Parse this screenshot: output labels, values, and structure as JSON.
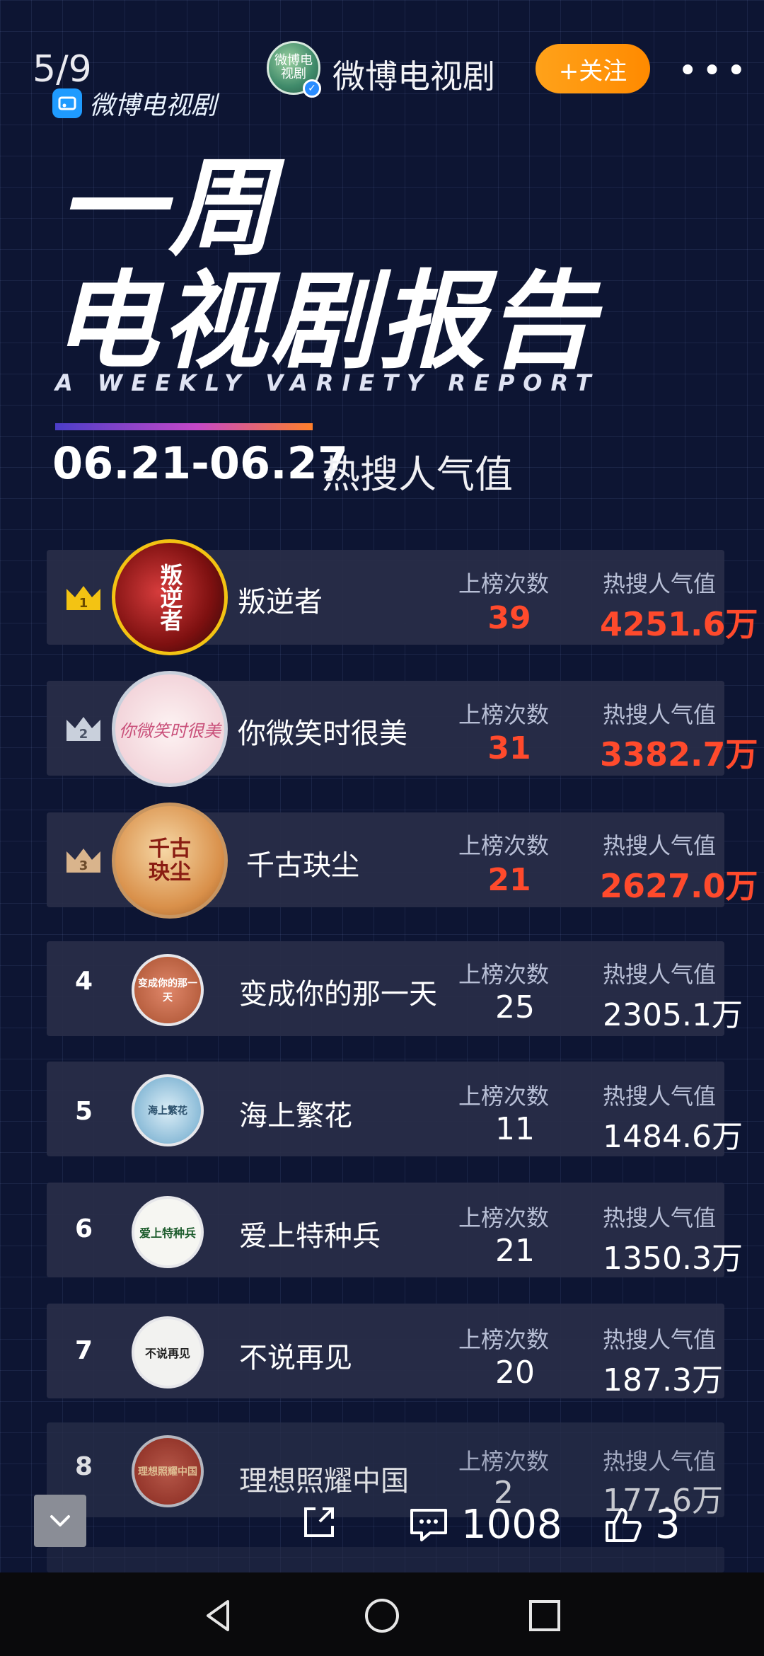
{
  "top_bar": {
    "counter": "5/9",
    "account_name": "微博电视剧",
    "avatar_text": "微博电视剧",
    "follow_label": "+关注",
    "more_label": "•••"
  },
  "brand": {
    "name": "微博电视剧"
  },
  "report": {
    "title_line1": "一周",
    "title_line2": "电视剧报告",
    "subtitle_en": "A WEEKLY VARIETY REPORT",
    "date_range": "06.21-06.27",
    "date_label": "热搜人气值"
  },
  "columns": {
    "count_label": "上榜次数",
    "heat_label": "热搜人气值"
  },
  "rows": [
    {
      "rank": "1",
      "name": "叛逆者",
      "count": "39",
      "heat": "4251.6万",
      "poster_text": "叛逆者"
    },
    {
      "rank": "2",
      "name": "你微笑时很美",
      "count": "31",
      "heat": "3382.7万",
      "poster_text": "你微笑时很美"
    },
    {
      "rank": "3",
      "name": "千古玦尘",
      "count": "21",
      "heat": "2627.0万",
      "poster_text": "千古玦尘"
    },
    {
      "rank": "4",
      "name": "变成你的那一天",
      "count": "25",
      "heat": "2305.1万",
      "poster_text": "变成你的那一天"
    },
    {
      "rank": "5",
      "name": "海上繁花",
      "count": "11",
      "heat": "1484.6万",
      "poster_text": "海上繁花"
    },
    {
      "rank": "6",
      "name": "爱上特种兵",
      "count": "21",
      "heat": "1350.3万",
      "poster_text": "爱上特种兵"
    },
    {
      "rank": "7",
      "name": "不说再见",
      "count": "20",
      "heat": "187.3万",
      "poster_text": "不说再见"
    },
    {
      "rank": "8",
      "name": "理想照耀中国",
      "count": "2",
      "heat": "177.6万",
      "poster_text": "理想照耀中国"
    }
  ],
  "actions": {
    "comment_count": "1008",
    "like_count": "3"
  },
  "colors": {
    "background": "#0d1533",
    "accent_red": "#ff4a2c",
    "follow_orange": "#ff9500",
    "gold": "#f3c313"
  },
  "icons": [
    "chevron-down-icon",
    "share-icon",
    "comment-icon",
    "like-icon",
    "back-icon",
    "home-icon",
    "recents-icon"
  ]
}
